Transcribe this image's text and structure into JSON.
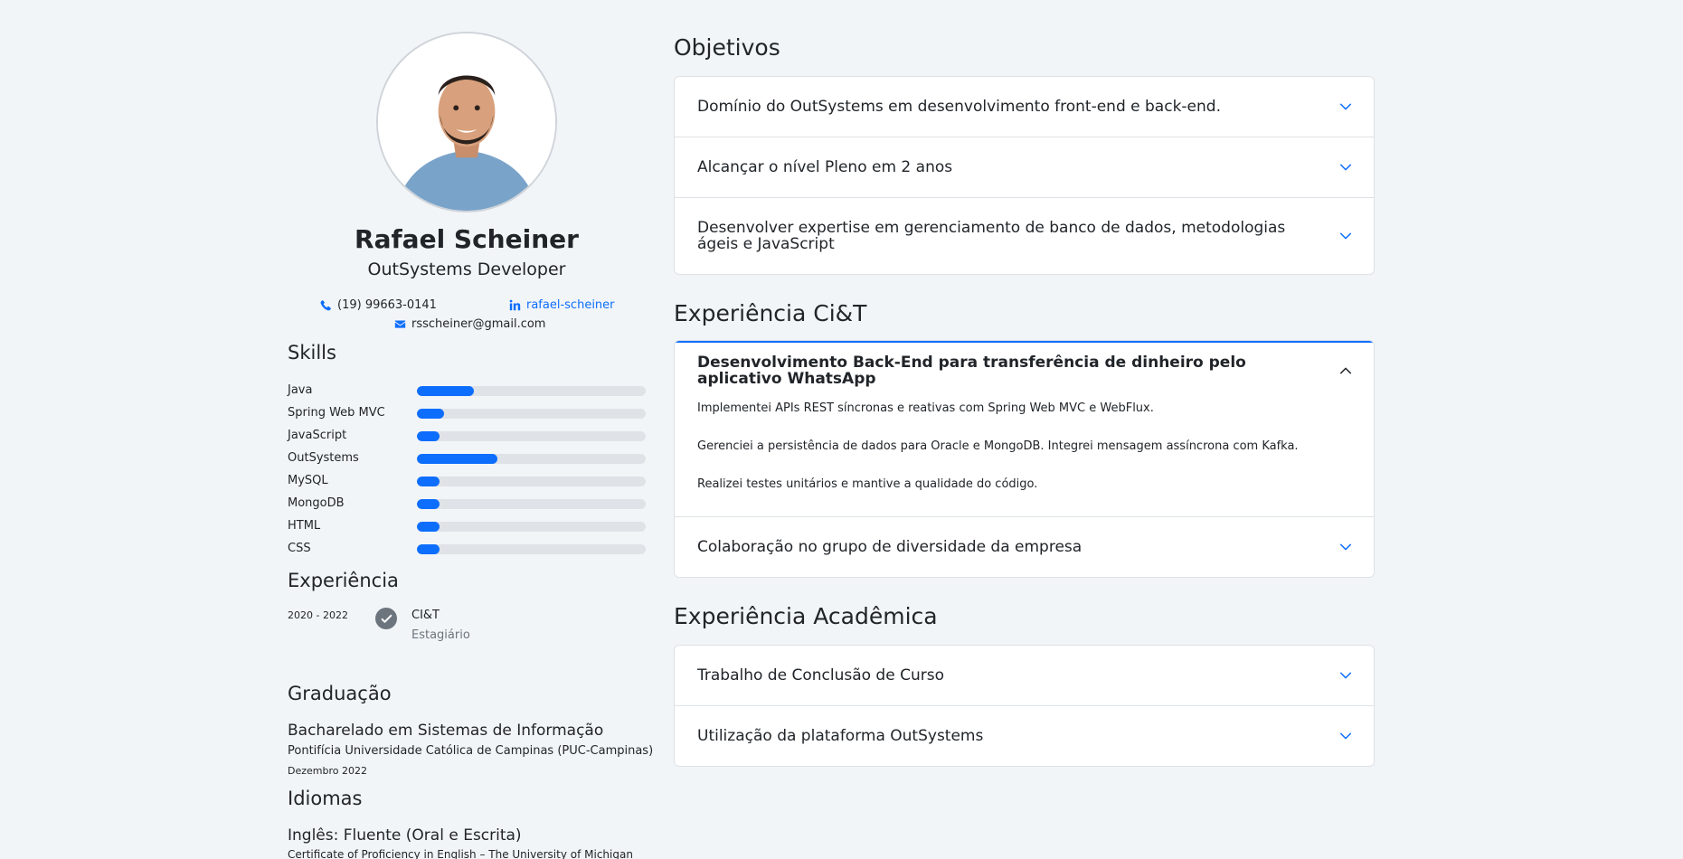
{
  "profile": {
    "name": "Rafael Scheiner",
    "role": "OutSystems Developer",
    "phone": "(19) 99663-0141",
    "linkedin": "rafael-scheiner",
    "email": "rsscheiner@gmail.com"
  },
  "skills": {
    "heading": "Skills",
    "items": [
      {
        "label": "Java",
        "level": 0.25
      },
      {
        "label": "Spring Web MVC",
        "level": 0.12
      },
      {
        "label": "JavaScript",
        "level": 0.1
      },
      {
        "label": "OutSystems",
        "level": 0.35
      },
      {
        "label": "MySQL",
        "level": 0.1
      },
      {
        "label": "MongoDB",
        "level": 0.1
      },
      {
        "label": "HTML",
        "level": 0.1
      },
      {
        "label": "CSS",
        "level": 0.1
      }
    ]
  },
  "experience": {
    "heading": "Experiência",
    "period": "2020 - 2022",
    "company": "CI&T",
    "title": "Estagiário"
  },
  "education": {
    "heading": "Graduação",
    "degree": "Bacharelado em Sistemas de Informação",
    "school": "Pontifícia Universidade Católica de Campinas (PUC-Campinas)",
    "date": "Dezembro 2022"
  },
  "languages": {
    "heading": "Idiomas",
    "main": "Inglês: Fluente (Oral e Escrita)",
    "cert": "Certificate of Proficiency in English – The University of Michigan"
  },
  "objectives": {
    "heading": "Objetivos",
    "items": [
      "Domínio do OutSystems em desenvolvimento front-end e back-end.",
      "Alcançar o nível Pleno em 2 anos",
      "Desenvolver expertise em gerenciamento de banco de dados, metodologias ágeis e JavaScript"
    ]
  },
  "cit": {
    "heading": "Experiência Ci&T",
    "open_item": {
      "title": "Desenvolvimento Back-End para transferência de dinheiro pelo aplicativo WhatsApp",
      "paragraphs": [
        "Implementei APIs REST síncronas e reativas com Spring Web MVC e WebFlux.",
        "Gerenciei a persistência de dados para Oracle e MongoDB. Integrei mensagem assíncrona com Kafka.",
        "Realizei testes unitários e mantive a qualidade do código."
      ]
    },
    "closed_item": "Colaboração no grupo de diversidade da empresa"
  },
  "academic": {
    "heading": "Experiência Acadêmica",
    "items": [
      "Trabalho de Conclusão de Curso",
      "Utilização da plataforma OutSystems"
    ]
  },
  "colors": {
    "accent": "#0d6efd",
    "background": "#f2f5f8",
    "track": "#dfe2e6",
    "muted": "#6c757d"
  },
  "icons": [
    "phone-icon",
    "linkedin-icon",
    "envelope-icon",
    "check-circle-icon",
    "chevron-down-icon",
    "chevron-up-icon"
  ]
}
